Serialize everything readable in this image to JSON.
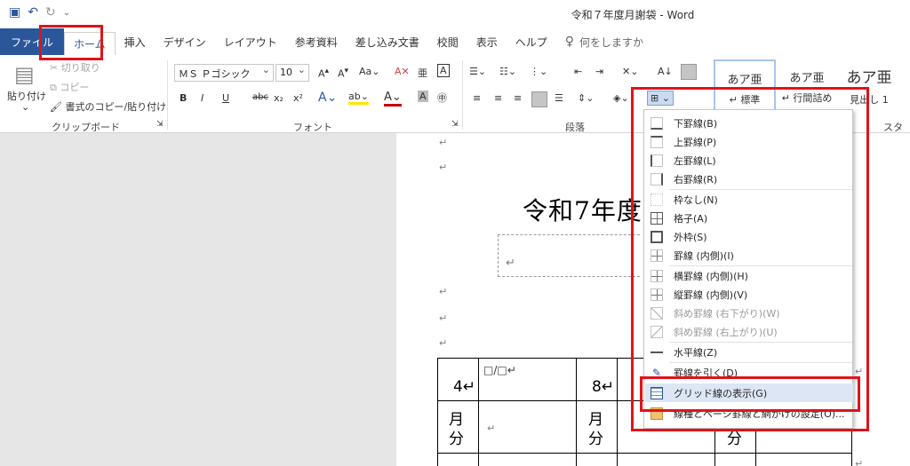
{
  "window": {
    "title": "令和７年度月謝袋 - Word"
  },
  "qat": {
    "save_icon": "save-icon",
    "undo_icon": "undo-icon",
    "redo_icon": "redo-icon"
  },
  "tabs": [
    {
      "label": "ファイル"
    },
    {
      "label": "ホーム"
    },
    {
      "label": "挿入"
    },
    {
      "label": "デザイン"
    },
    {
      "label": "レイアウト"
    },
    {
      "label": "参考資料"
    },
    {
      "label": "差し込み文書"
    },
    {
      "label": "校閲"
    },
    {
      "label": "表示"
    },
    {
      "label": "ヘルプ"
    }
  ],
  "tell_me": "何をしますか",
  "clipboard": {
    "paste": "貼り付け",
    "cut": "切り取り",
    "copy": "コピー",
    "format_painter": "書式のコピー/貼り付け",
    "label": "クリップボード"
  },
  "font": {
    "name": "ＭＳ Ｐゴシック",
    "size": "10",
    "label": "フォント",
    "bold": "B",
    "italic": "I",
    "underline": "U",
    "strike": "abc",
    "sub": "x₂",
    "sup": "x²"
  },
  "paragraph": {
    "label": "段落"
  },
  "styles": {
    "label": "スタイル",
    "items": [
      {
        "sample": "あア亜",
        "name": "↵ 標準"
      },
      {
        "sample": "あア亜",
        "name": "↵ 行間詰め"
      },
      {
        "sample": "あア亜",
        "name": "見出し 1"
      }
    ]
  },
  "document": {
    "heading": "令和7年度",
    "cells": [
      "4↵",
      "月",
      "分",
      "8↵",
      "月",
      "分",
      "分"
    ],
    "placeholder": "□/□↵"
  },
  "border_menu": {
    "items": [
      {
        "label": "下罫線(B)",
        "icon": "border-bottom-icon",
        "disabled": false
      },
      {
        "label": "上罫線(P)",
        "icon": "border-top-icon",
        "disabled": false
      },
      {
        "label": "左罫線(L)",
        "icon": "border-left-icon",
        "disabled": false
      },
      {
        "label": "右罫線(R)",
        "icon": "border-right-icon",
        "disabled": false
      },
      {
        "label": "枠なし(N)",
        "icon": "no-border-icon",
        "disabled": false
      },
      {
        "label": "格子(A)",
        "icon": "all-borders-icon",
        "disabled": false
      },
      {
        "label": "外枠(S)",
        "icon": "outside-borders-icon",
        "disabled": false
      },
      {
        "label": "罫線 (内側)(I)",
        "icon": "inside-borders-icon",
        "disabled": false
      },
      {
        "label": "横罫線 (内側)(H)",
        "icon": "inside-horizontal-icon",
        "disabled": false
      },
      {
        "label": "縦罫線 (内側)(V)",
        "icon": "inside-vertical-icon",
        "disabled": false
      },
      {
        "label": "斜め罫線 (右下がり)(W)",
        "icon": "diagonal-down-icon",
        "disabled": true
      },
      {
        "label": "斜め罫線 (右上がり)(U)",
        "icon": "diagonal-up-icon",
        "disabled": true
      },
      {
        "label": "水平線(Z)",
        "icon": "horizontal-line-icon",
        "disabled": false
      },
      {
        "label": "罫線を引く(D)",
        "icon": "draw-table-icon",
        "disabled": false
      },
      {
        "label": "グリッド線の表示(G)",
        "icon": "view-gridlines-icon",
        "disabled": false
      },
      {
        "label": "線種とページ罫線と網かけの設定(O)...",
        "icon": "borders-shading-icon",
        "disabled": false
      }
    ]
  },
  "colors": {
    "accent": "#2b579a",
    "annotation": "#e0131b",
    "highlight": "#dce6f4"
  }
}
